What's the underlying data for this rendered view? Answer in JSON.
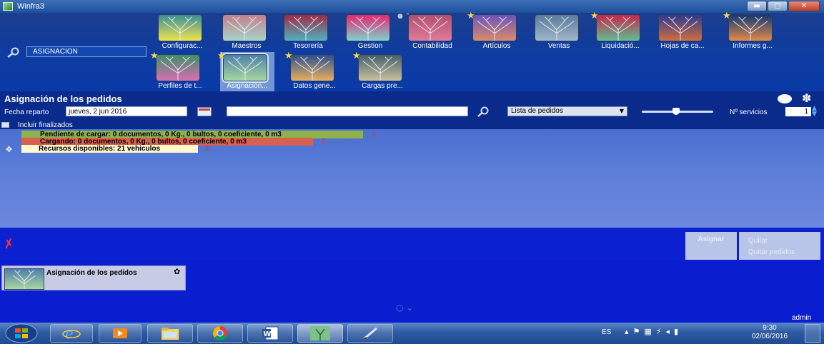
{
  "window": {
    "title": "Winfra3",
    "controls": {
      "minimize": "▬",
      "maximize": "▢",
      "close": "✕"
    }
  },
  "search": {
    "value": "ASIGNACION"
  },
  "tiles": [
    {
      "label": "Configurac...",
      "star": false,
      "colors": [
        "#3a8f95",
        "#f2e34b"
      ]
    },
    {
      "label": "Maestros",
      "star": false,
      "colors": [
        "#c37f8e",
        "#a6d3c8"
      ]
    },
    {
      "label": "Tesorería",
      "star": false,
      "colors": [
        "#9e2b45",
        "#4fb2c2"
      ]
    },
    {
      "label": "Gestion",
      "star": false,
      "colors": [
        "#e5266e",
        "#7fd3d0"
      ]
    },
    {
      "label": "Contabilidad",
      "star": false,
      "colors": [
        "#b05070",
        "#e07b9b"
      ]
    },
    {
      "label": "Artículos",
      "star": true,
      "colors": [
        "#6b54b8",
        "#d98b6c"
      ]
    },
    {
      "label": "Ventas",
      "star": false,
      "colors": [
        "#5b7b9b",
        "#9fb6c8"
      ]
    },
    {
      "label": "Liquidació...",
      "star": true,
      "colors": [
        "#c7264a",
        "#5fbf95"
      ]
    },
    {
      "label": "Hojas de ca...",
      "star": false,
      "colors": [
        "#2f3a8f",
        "#cf6e3f"
      ]
    },
    {
      "label": "Informes g...",
      "star": true,
      "colors": [
        "#173a6f",
        "#e08a4a"
      ]
    },
    {
      "label": "Perfiles de t...",
      "star": true,
      "colors": [
        "#3e8f6a",
        "#d96fb0"
      ]
    },
    {
      "label": "Asignación...",
      "star": true,
      "selected": true,
      "colors": [
        "#4f7fa8",
        "#a7d8a0"
      ]
    },
    {
      "label": "Datos gene...",
      "star": true,
      "colors": [
        "#2e4f8f",
        "#e8b060"
      ]
    },
    {
      "label": "Cargas pre...",
      "star": true,
      "colors": [
        "#45606a",
        "#c9c2a0"
      ]
    }
  ],
  "page": {
    "title": "Asignación de los pedidos",
    "fecha_label": "Fecha reparto",
    "fecha_value": "jueves, 2 jun 2016",
    "list_select": "Lista de pedidos",
    "servicios_label": "Nº servicios",
    "servicios_value": "1",
    "slider_level": 0.48,
    "incluir_label": "Incluir finalizados"
  },
  "status_rows": [
    {
      "text": "Pendiente de cargar:   0 documentos, 0 Kg., 0 bultos, 0 coeficiente, 0 m3",
      "num": "1",
      "color": "#8fb14c"
    },
    {
      "text": "Cargando:   0 documentos, 0 Kg., 0 bultos, 0 coeficiente, 0 m3",
      "num": "2",
      "color": "#d86050"
    },
    {
      "text": "Recursos disponibles:   21 vehiculos",
      "num": "3",
      "color": "#fff8cc"
    }
  ],
  "actions": {
    "asignar": "Asignar",
    "quitar": "Quitar",
    "quitar_pedidos": "Quitar pedidos"
  },
  "open_window": {
    "name": "Asignación de los pedidos"
  },
  "footer": {
    "user": "admin"
  },
  "taskbar": {
    "lang": "ES",
    "time": "9:30",
    "date": "02/06/2016"
  }
}
